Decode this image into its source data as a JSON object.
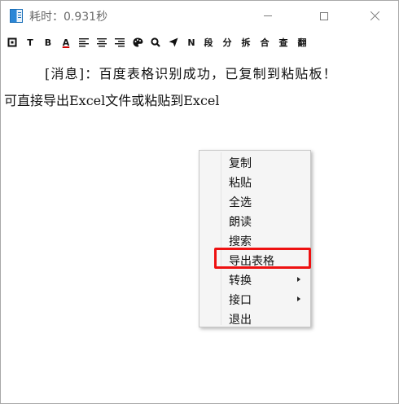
{
  "window": {
    "title": "耗时：0.931秒",
    "icon": "app-icon",
    "controls": {
      "minimize": "minimize-icon",
      "maximize": "maximize-icon",
      "close": "close-icon"
    }
  },
  "toolbar": {
    "items": [
      {
        "name": "toolbar-box-button",
        "icon": "box-icon"
      },
      {
        "name": "toolbar-text-button",
        "label": "T"
      },
      {
        "name": "toolbar-bold-button",
        "label": "B"
      },
      {
        "name": "toolbar-font-color-button",
        "label": "A"
      },
      {
        "name": "toolbar-align-left-button",
        "icon": "align-left-icon"
      },
      {
        "name": "toolbar-align-center-button",
        "icon": "align-center-icon"
      },
      {
        "name": "toolbar-align-right-button",
        "icon": "align-right-icon"
      },
      {
        "name": "toolbar-palette-button",
        "icon": "palette-icon"
      },
      {
        "name": "toolbar-search-button",
        "icon": "search-icon"
      },
      {
        "name": "toolbar-send-button",
        "icon": "send-icon"
      },
      {
        "name": "toolbar-n-button",
        "label": "N"
      },
      {
        "name": "toolbar-segment-button",
        "label": "段"
      },
      {
        "name": "toolbar-split-button",
        "label": "分"
      },
      {
        "name": "toolbar-separate-button",
        "label": "拆"
      },
      {
        "name": "toolbar-merge-button",
        "label": "合"
      },
      {
        "name": "toolbar-lookup-button",
        "label": "查"
      },
      {
        "name": "toolbar-translate-button",
        "label": "翻"
      }
    ]
  },
  "content": {
    "line1": "[消息]：百度表格识别成功，已复制到粘贴板！",
    "line2": "可直接导出Excel文件或粘贴到Excel"
  },
  "context_menu": {
    "items": [
      {
        "label": "复制",
        "submenu": false
      },
      {
        "label": "粘贴",
        "submenu": false
      },
      {
        "label": "全选",
        "submenu": false
      },
      {
        "label": "朗读",
        "submenu": false
      },
      {
        "label": "搜索",
        "submenu": false
      },
      {
        "label": "导出表格",
        "submenu": false,
        "highlighted": true
      },
      {
        "label": "转换",
        "submenu": true
      },
      {
        "label": "接口",
        "submenu": true
      },
      {
        "label": "退出",
        "submenu": false
      }
    ]
  },
  "colors": {
    "highlight_border": "#ee1111",
    "font_color_underline": "#d00000"
  }
}
